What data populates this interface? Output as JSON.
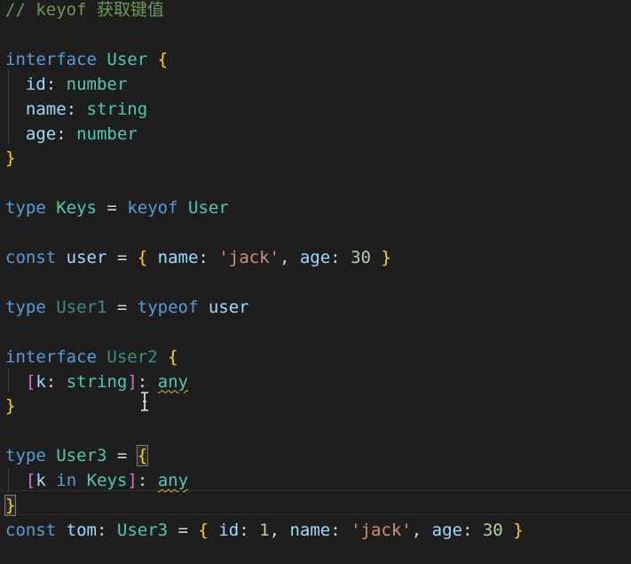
{
  "editor": {
    "lines": [
      [
        {
          "t": "// keyof 获取键值",
          "c": "cm"
        }
      ],
      [],
      [
        {
          "t": "interface",
          "c": "kw"
        },
        {
          "t": " "
        },
        {
          "t": "User",
          "c": "ty"
        },
        {
          "t": " "
        },
        {
          "t": "{",
          "c": "br1"
        }
      ],
      [
        {
          "t": "  "
        },
        {
          "t": "id",
          "c": "var"
        },
        {
          "t": ": ",
          "c": "pr"
        },
        {
          "t": "number",
          "c": "ty"
        }
      ],
      [
        {
          "t": "  "
        },
        {
          "t": "name",
          "c": "var"
        },
        {
          "t": ": ",
          "c": "pr"
        },
        {
          "t": "string",
          "c": "ty"
        }
      ],
      [
        {
          "t": "  "
        },
        {
          "t": "age",
          "c": "var"
        },
        {
          "t": ": ",
          "c": "pr"
        },
        {
          "t": "number",
          "c": "ty"
        }
      ],
      [
        {
          "t": "}",
          "c": "br1"
        }
      ],
      [],
      [
        {
          "t": "type",
          "c": "kw"
        },
        {
          "t": " "
        },
        {
          "t": "Keys",
          "c": "ty"
        },
        {
          "t": " = ",
          "c": "pr"
        },
        {
          "t": "keyof",
          "c": "kw"
        },
        {
          "t": " "
        },
        {
          "t": "User",
          "c": "ty"
        }
      ],
      [],
      [
        {
          "t": "const",
          "c": "kw"
        },
        {
          "t": " "
        },
        {
          "t": "user",
          "c": "var"
        },
        {
          "t": " = ",
          "c": "pr"
        },
        {
          "t": "{",
          "c": "br1"
        },
        {
          "t": " "
        },
        {
          "t": "name",
          "c": "var"
        },
        {
          "t": ": ",
          "c": "pr"
        },
        {
          "t": "'jack'",
          "c": "str"
        },
        {
          "t": ", ",
          "c": "pr"
        },
        {
          "t": "age",
          "c": "var"
        },
        {
          "t": ": ",
          "c": "pr"
        },
        {
          "t": "30",
          "c": "num"
        },
        {
          "t": " "
        },
        {
          "t": "}",
          "c": "br1"
        }
      ],
      [],
      [
        {
          "t": "type",
          "c": "kw"
        },
        {
          "t": " "
        },
        {
          "t": "User1",
          "c": "ty-dim"
        },
        {
          "t": " = ",
          "c": "pr"
        },
        {
          "t": "typeof",
          "c": "kw"
        },
        {
          "t": " "
        },
        {
          "t": "user",
          "c": "var"
        }
      ],
      [],
      [
        {
          "t": "interface",
          "c": "kw"
        },
        {
          "t": " "
        },
        {
          "t": "User2",
          "c": "ty-dim"
        },
        {
          "t": " "
        },
        {
          "t": "{",
          "c": "br1"
        }
      ],
      [
        {
          "t": "  "
        },
        {
          "t": "[",
          "c": "br2"
        },
        {
          "t": "k",
          "c": "var"
        },
        {
          "t": ": ",
          "c": "pr"
        },
        {
          "t": "string",
          "c": "ty"
        },
        {
          "t": "]",
          "c": "br2"
        },
        {
          "t": ": ",
          "c": "pr"
        },
        {
          "t": "any",
          "c": "ty squig"
        }
      ],
      [
        {
          "t": "}",
          "c": "br1"
        }
      ],
      [],
      [
        {
          "t": "type",
          "c": "kw"
        },
        {
          "t": " "
        },
        {
          "t": "User3",
          "c": "ty"
        },
        {
          "t": " = ",
          "c": "pr"
        },
        {
          "t": "{",
          "c": "br1 match"
        }
      ],
      [
        {
          "t": "  "
        },
        {
          "t": "[",
          "c": "br2"
        },
        {
          "t": "k",
          "c": "var"
        },
        {
          "t": " "
        },
        {
          "t": "in",
          "c": "kw"
        },
        {
          "t": " "
        },
        {
          "t": "Keys",
          "c": "ty"
        },
        {
          "t": "]",
          "c": "br2"
        },
        {
          "t": ": ",
          "c": "pr"
        },
        {
          "t": "any",
          "c": "ty squig"
        }
      ],
      [
        {
          "t": "}",
          "c": "br1 match"
        }
      ],
      [
        {
          "t": "const",
          "c": "kw"
        },
        {
          "t": " "
        },
        {
          "t": "tom",
          "c": "var"
        },
        {
          "t": ": ",
          "c": "pr"
        },
        {
          "t": "User3",
          "c": "ty"
        },
        {
          "t": " = ",
          "c": "pr"
        },
        {
          "t": "{",
          "c": "br1"
        },
        {
          "t": " "
        },
        {
          "t": "id",
          "c": "var"
        },
        {
          "t": ": ",
          "c": "pr"
        },
        {
          "t": "1",
          "c": "num"
        },
        {
          "t": ", ",
          "c": "pr"
        },
        {
          "t": "name",
          "c": "var"
        },
        {
          "t": ": ",
          "c": "pr"
        },
        {
          "t": "'jack'",
          "c": "str"
        },
        {
          "t": ", ",
          "c": "pr"
        },
        {
          "t": "age",
          "c": "var"
        },
        {
          "t": ": ",
          "c": "pr"
        },
        {
          "t": "30",
          "c": "num"
        },
        {
          "t": " "
        },
        {
          "t": "}",
          "c": "br1"
        }
      ]
    ]
  },
  "cursor": {
    "icon": "text-ibeam-icon"
  }
}
